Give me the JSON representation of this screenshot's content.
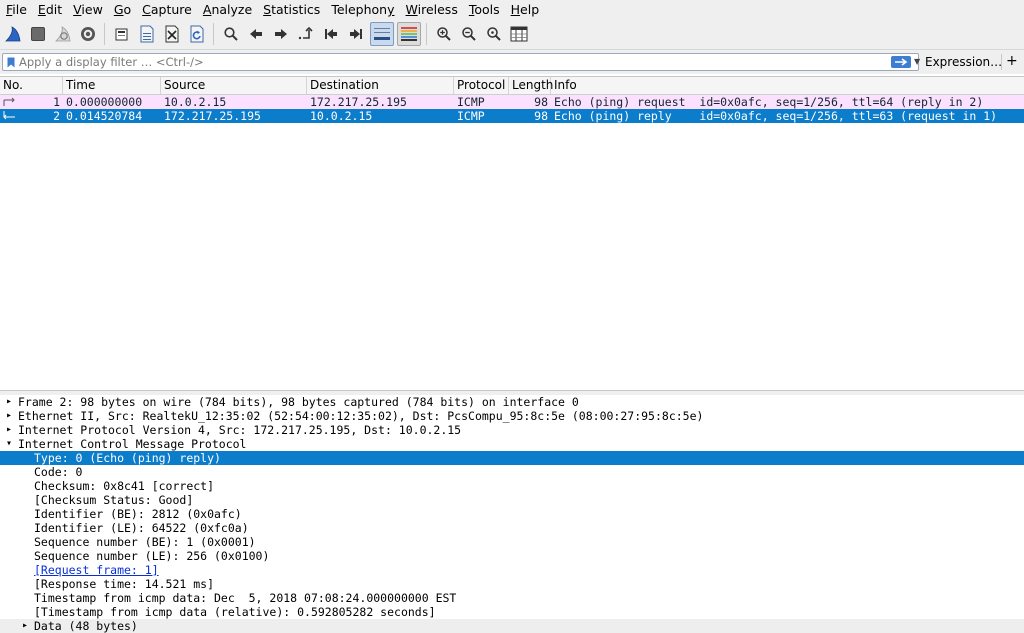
{
  "menu": [
    {
      "label": "File",
      "u": "F",
      "rest": "ile"
    },
    {
      "label": "Edit",
      "u": "E",
      "rest": "dit"
    },
    {
      "label": "View",
      "u": "V",
      "rest": "iew"
    },
    {
      "label": "Go",
      "u": "G",
      "rest": "o"
    },
    {
      "label": "Capture",
      "u": "C",
      "rest": "apture"
    },
    {
      "label": "Analyze",
      "u": "A",
      "rest": "nalyze"
    },
    {
      "label": "Statistics",
      "u": "S",
      "rest": "tatistics"
    },
    {
      "label": "Telephony",
      "u": "",
      "rest": "Telephony",
      "pre": "Telephon",
      "uu": "y"
    },
    {
      "label": "Wireless",
      "u": "W",
      "rest": "ireless"
    },
    {
      "label": "Tools",
      "u": "T",
      "rest": "ools"
    },
    {
      "label": "Help",
      "u": "H",
      "rest": "elp"
    }
  ],
  "toolbar": {
    "icons": [
      "shark-fin-start-icon",
      "stop-square-icon",
      "restart-fin-icon",
      "capture-options-gear-icon",
      "open-folder-icon",
      "save-file-icon",
      "close-file-icon",
      "reload-icon",
      "find-packet-icon",
      "go-back-icon",
      "go-forward-icon",
      "go-to-packet-icon",
      "first-packet-icon",
      "last-packet-icon",
      "autoscroll-icon",
      "colorize-icon",
      "zoom-in-icon",
      "zoom-out-icon",
      "zoom-normal-icon",
      "resize-columns-icon"
    ]
  },
  "filter": {
    "placeholder": "Apply a display filter … <Ctrl-/>",
    "value": "",
    "expression_label": "Expression…",
    "add_label": "+"
  },
  "columns": [
    "No.",
    "Time",
    "Source",
    "Destination",
    "Protocol",
    "Length",
    "Info"
  ],
  "packets": [
    {
      "no": "1",
      "time": "0.000000000",
      "source": "10.0.2.15",
      "destination": "172.217.25.195",
      "protocol": "ICMP",
      "length": "98",
      "info": "Echo (ping) request  id=0x0afc, seq=1/256, ttl=64 (reply in 2)",
      "state": "request"
    },
    {
      "no": "2",
      "time": "0.014520784",
      "source": "172.217.25.195",
      "destination": "10.0.2.15",
      "protocol": "ICMP",
      "length": "98",
      "info": "Echo (ping) reply    id=0x0afc, seq=1/256, ttl=63 (request in 1)",
      "state": "selected"
    }
  ],
  "details": [
    {
      "text": "Frame 2: 98 bytes on wire (784 bits), 98 bytes captured (784 bits) on interface 0",
      "level": 0,
      "expander": "collapsed"
    },
    {
      "text": "Ethernet II, Src: RealtekU_12:35:02 (52:54:00:12:35:02), Dst: PcsCompu_95:8c:5e (08:00:27:95:8c:5e)",
      "level": 0,
      "expander": "collapsed"
    },
    {
      "text": "Internet Protocol Version 4, Src: 172.217.25.195, Dst: 10.0.2.15",
      "level": 0,
      "expander": "collapsed"
    },
    {
      "text": "Internet Control Message Protocol",
      "level": 0,
      "expander": "expanded"
    },
    {
      "text": "Type: 0 (Echo (ping) reply)",
      "level": 1,
      "expander": "none",
      "selected": true
    },
    {
      "text": "Code: 0",
      "level": 1,
      "expander": "none"
    },
    {
      "text": "Checksum: 0x8c41 [correct]",
      "level": 1,
      "expander": "none"
    },
    {
      "text": "[Checksum Status: Good]",
      "level": 1,
      "expander": "none"
    },
    {
      "text": "Identifier (BE): 2812 (0x0afc)",
      "level": 1,
      "expander": "none"
    },
    {
      "text": "Identifier (LE): 64522 (0xfc0a)",
      "level": 1,
      "expander": "none"
    },
    {
      "text": "Sequence number (BE): 1 (0x0001)",
      "level": 1,
      "expander": "none"
    },
    {
      "text": "Sequence number (LE): 256 (0x0100)",
      "level": 1,
      "expander": "none"
    },
    {
      "text": "[Request frame: 1]",
      "level": 1,
      "expander": "none",
      "link": true
    },
    {
      "text": "[Response time: 14.521 ms]",
      "level": 1,
      "expander": "none"
    },
    {
      "text": "Timestamp from icmp data: Dec  5, 2018 07:08:24.000000000 EST",
      "level": 1,
      "expander": "none"
    },
    {
      "text": "[Timestamp from icmp data (relative): 0.592805282 seconds]",
      "level": 1,
      "expander": "none"
    },
    {
      "text": "Data (48 bytes)",
      "level": 1,
      "expander": "collapsed",
      "shaded": true
    }
  ],
  "colors": {
    "accent": "#0b7dcb",
    "request_row": "#fce0ff",
    "link": "#0b2fd6"
  }
}
